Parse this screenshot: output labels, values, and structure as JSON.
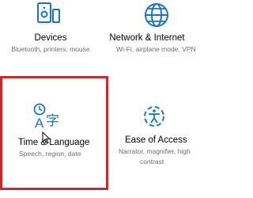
{
  "colors": {
    "accent": "#1a73c8",
    "highlight_border": "#c9282d",
    "description_text": "#6d6d6d"
  },
  "tiles": [
    {
      "id": "devices",
      "icon": "devices-icon",
      "title": "Devices",
      "description": "Bluetooth, printers, mouse"
    },
    {
      "id": "network",
      "icon": "globe-icon",
      "title": "Network & Internet",
      "description": "Wi-Fi, airplane mode, VPN"
    },
    {
      "id": "time_language",
      "icon": "time-language-icon",
      "title": "Time & Language",
      "description": "Speech, region, date",
      "highlighted": true
    },
    {
      "id": "ease_of_access",
      "icon": "ease-of-access-icon",
      "title": "Ease of Access",
      "description_line1": "Narrator, magnifier, high",
      "description_line2": "contrast"
    }
  ]
}
